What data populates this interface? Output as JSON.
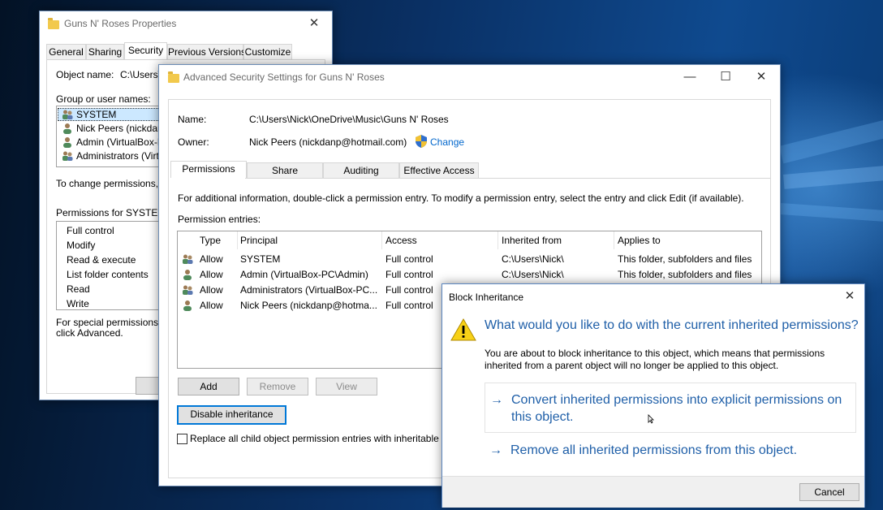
{
  "properties_window": {
    "title": "Guns N' Roses Properties",
    "tabs": [
      "General",
      "Sharing",
      "Security",
      "Previous Versions",
      "Customize"
    ],
    "object_name_label": "Object name:",
    "object_name_value": "C:\\Users\\",
    "group_label": "Group or user names:",
    "users": [
      "SYSTEM",
      "Nick Peers (nickdanp",
      "Admin (VirtualBox-PC\\",
      "Administrators (VirtualB"
    ],
    "change_text": "To change permissions, clic",
    "permissions_for": "Permissions for SYSTEM",
    "permissions": [
      "Full control",
      "Modify",
      "Read & execute",
      "List folder contents",
      "Read",
      "Write"
    ],
    "special_line1": "For special permissions or a",
    "special_line2": "click Advanced."
  },
  "advanced_window": {
    "title": "Advanced Security Settings for Guns N' Roses",
    "name_label": "Name:",
    "name_value": "C:\\Users\\Nick\\OneDrive\\Music\\Guns N' Roses",
    "owner_label": "Owner:",
    "owner_value": "Nick Peers (nickdanp@hotmail.com)",
    "change_link": "Change",
    "tabs": [
      "Permissions",
      "Share",
      "Auditing",
      "Effective Access"
    ],
    "info_text": "For additional information, double-click a permission entry. To modify a permission entry, select the entry and click Edit (if available).",
    "entries_label": "Permission entries:",
    "columns": [
      "Type",
      "Principal",
      "Access",
      "Inherited from",
      "Applies to"
    ],
    "rows": [
      {
        "type": "Allow",
        "principal": "SYSTEM",
        "access": "Full control",
        "inherited": "C:\\Users\\Nick\\",
        "applies": "This folder, subfolders and files"
      },
      {
        "type": "Allow",
        "principal": "Admin (VirtualBox-PC\\Admin)",
        "access": "Full control",
        "inherited": "C:\\Users\\Nick\\",
        "applies": "This folder, subfolders and files"
      },
      {
        "type": "Allow",
        "principal": "Administrators (VirtualBox-PC...",
        "access": "Full control",
        "inherited": "",
        "applies": ""
      },
      {
        "type": "Allow",
        "principal": "Nick Peers (nickdanp@hotma...",
        "access": "Full control",
        "inherited": "",
        "applies": ""
      }
    ],
    "add_button": "Add",
    "remove_button": "Remove",
    "view_button": "View",
    "disable_button": "Disable inheritance",
    "replace_label": "Replace all child object permission entries with inheritable p"
  },
  "block_dialog": {
    "title": "Block Inheritance",
    "question": "What would you like to do with the current inherited permissions?",
    "desc_line1": "You are about to block inheritance to this object, which means that permissions",
    "desc_line2": "inherited from a parent object will no longer be applied to this object.",
    "option1_line1": "Convert inherited permissions into explicit permissions on",
    "option1_line2": "this object.",
    "option2": "Remove all inherited permissions from this object.",
    "cancel_button": "Cancel"
  },
  "colors": {
    "accent": "#0078d7",
    "link": "#1f5fa8",
    "warning": "#f7d117"
  }
}
